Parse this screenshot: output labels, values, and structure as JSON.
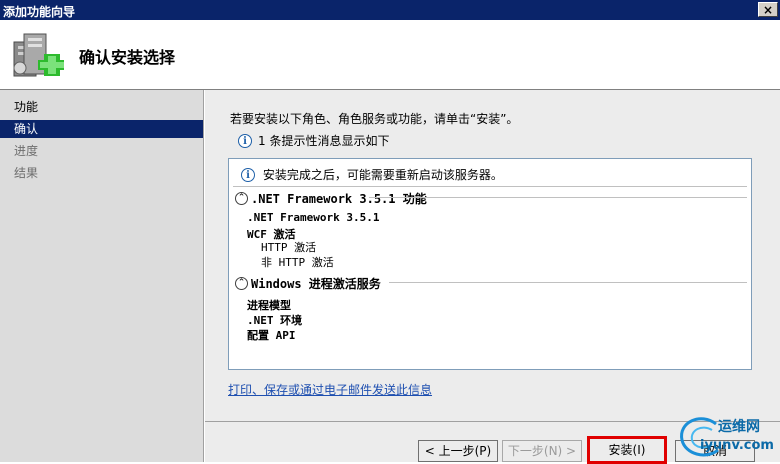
{
  "window": {
    "title": "添加功能向导",
    "close_glyph": "×"
  },
  "header": {
    "title": "确认安装选择",
    "icon": "server-add-icon"
  },
  "nav": {
    "items": [
      {
        "label": "功能",
        "state": "normal"
      },
      {
        "label": "确认",
        "state": "active"
      },
      {
        "label": "进度",
        "state": "dim"
      },
      {
        "label": "结果",
        "state": "dim"
      }
    ]
  },
  "main": {
    "instruction": "若要安装以下角色、角色服务或功能，请单击“安装”。",
    "notice": "1 条提示性消息显示如下",
    "info_message": "安装完成之后，可能需要重新启动该服务器。",
    "sections": [
      {
        "title": ".NET Framework 3.5.1 功能",
        "items": [
          ".NET Framework 3.5.1",
          "WCF 激活",
          "HTTP 激活",
          "非 HTTP 激活"
        ]
      },
      {
        "title": "Windows 进程激活服务",
        "items": [
          "进程模型",
          ".NET 环境",
          "配置 API"
        ]
      }
    ],
    "link": "打印、保存或通过电子邮件发送此信息"
  },
  "buttons": {
    "prev": "< 上一步(P)",
    "next": "下一步(N) >",
    "install": "安装(I)",
    "cancel": "取消"
  },
  "watermark": {
    "line1": "运维网",
    "line2": "iyunv.com"
  },
  "colors": {
    "titlebar": "#0a246a",
    "nav_active": "#0a246a",
    "highlight_border": "#e00000",
    "link": "#1e4fb0"
  }
}
